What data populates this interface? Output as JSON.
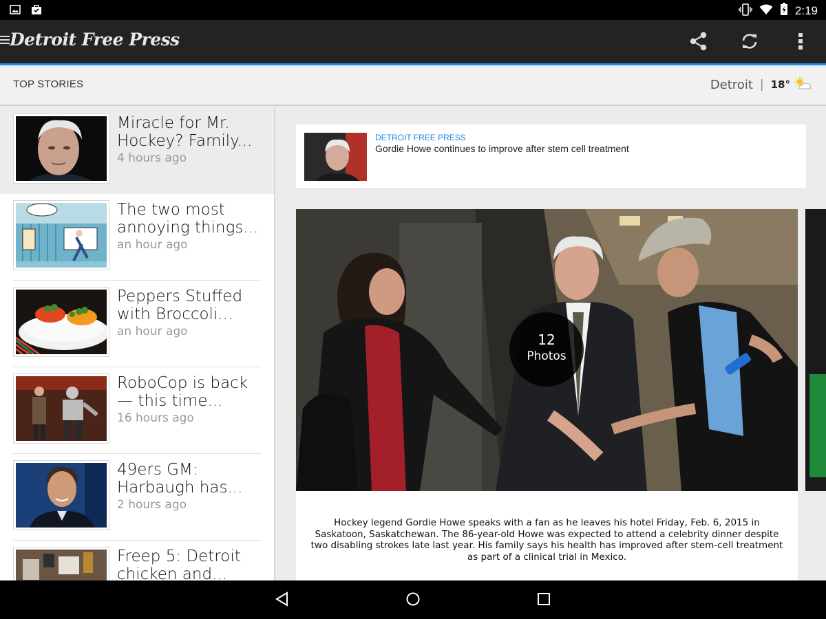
{
  "status_bar": {
    "time": "2:19"
  },
  "app": {
    "logo": "Detroit Free Press",
    "actions": [
      {
        "name": "share-icon"
      },
      {
        "name": "refresh-icon"
      },
      {
        "name": "more-vert-icon"
      }
    ]
  },
  "section": {
    "title": "TOP STORIES",
    "weather": {
      "city": "Detroit",
      "separator": "|",
      "temp": "18°",
      "icon": "partly-cloudy-icon"
    }
  },
  "stories": [
    {
      "headline": "Miracle for Mr. Hockey? Family...",
      "time": "4 hours ago",
      "active": true
    },
    {
      "headline": "The two most annoying things...",
      "time": "an hour ago"
    },
    {
      "headline": "Peppers Stuffed with Broccoli...",
      "time": "an hour ago"
    },
    {
      "headline": "RoboCop is back — this time...",
      "time": "16 hours ago"
    },
    {
      "headline": "49ers GM: Harbaugh has...",
      "time": "2 hours ago"
    },
    {
      "headline": "Freep 5: Detroit chicken and...",
      "time": ""
    }
  ],
  "related": {
    "source": "DETROIT FREE PRESS",
    "title": "Gordie Howe continues to improve after stem cell treatment"
  },
  "gallery": {
    "count": "12",
    "count_label": "Photos",
    "caption": "Hockey legend Gordie Howe speaks with a fan as he leaves his hotel Friday, Feb. 6, 2015 in Saskatoon, Saskatchewan. The 86-year-old Howe was expected to attend a celebrity dinner despite two disabling strokes late last year. His family says his health has improved after stem-cell treatment as part of a clinical trial in Mexico."
  },
  "colors": {
    "accent": "#1e88e5",
    "app_bar": "#232323",
    "status_bar": "#000000"
  }
}
